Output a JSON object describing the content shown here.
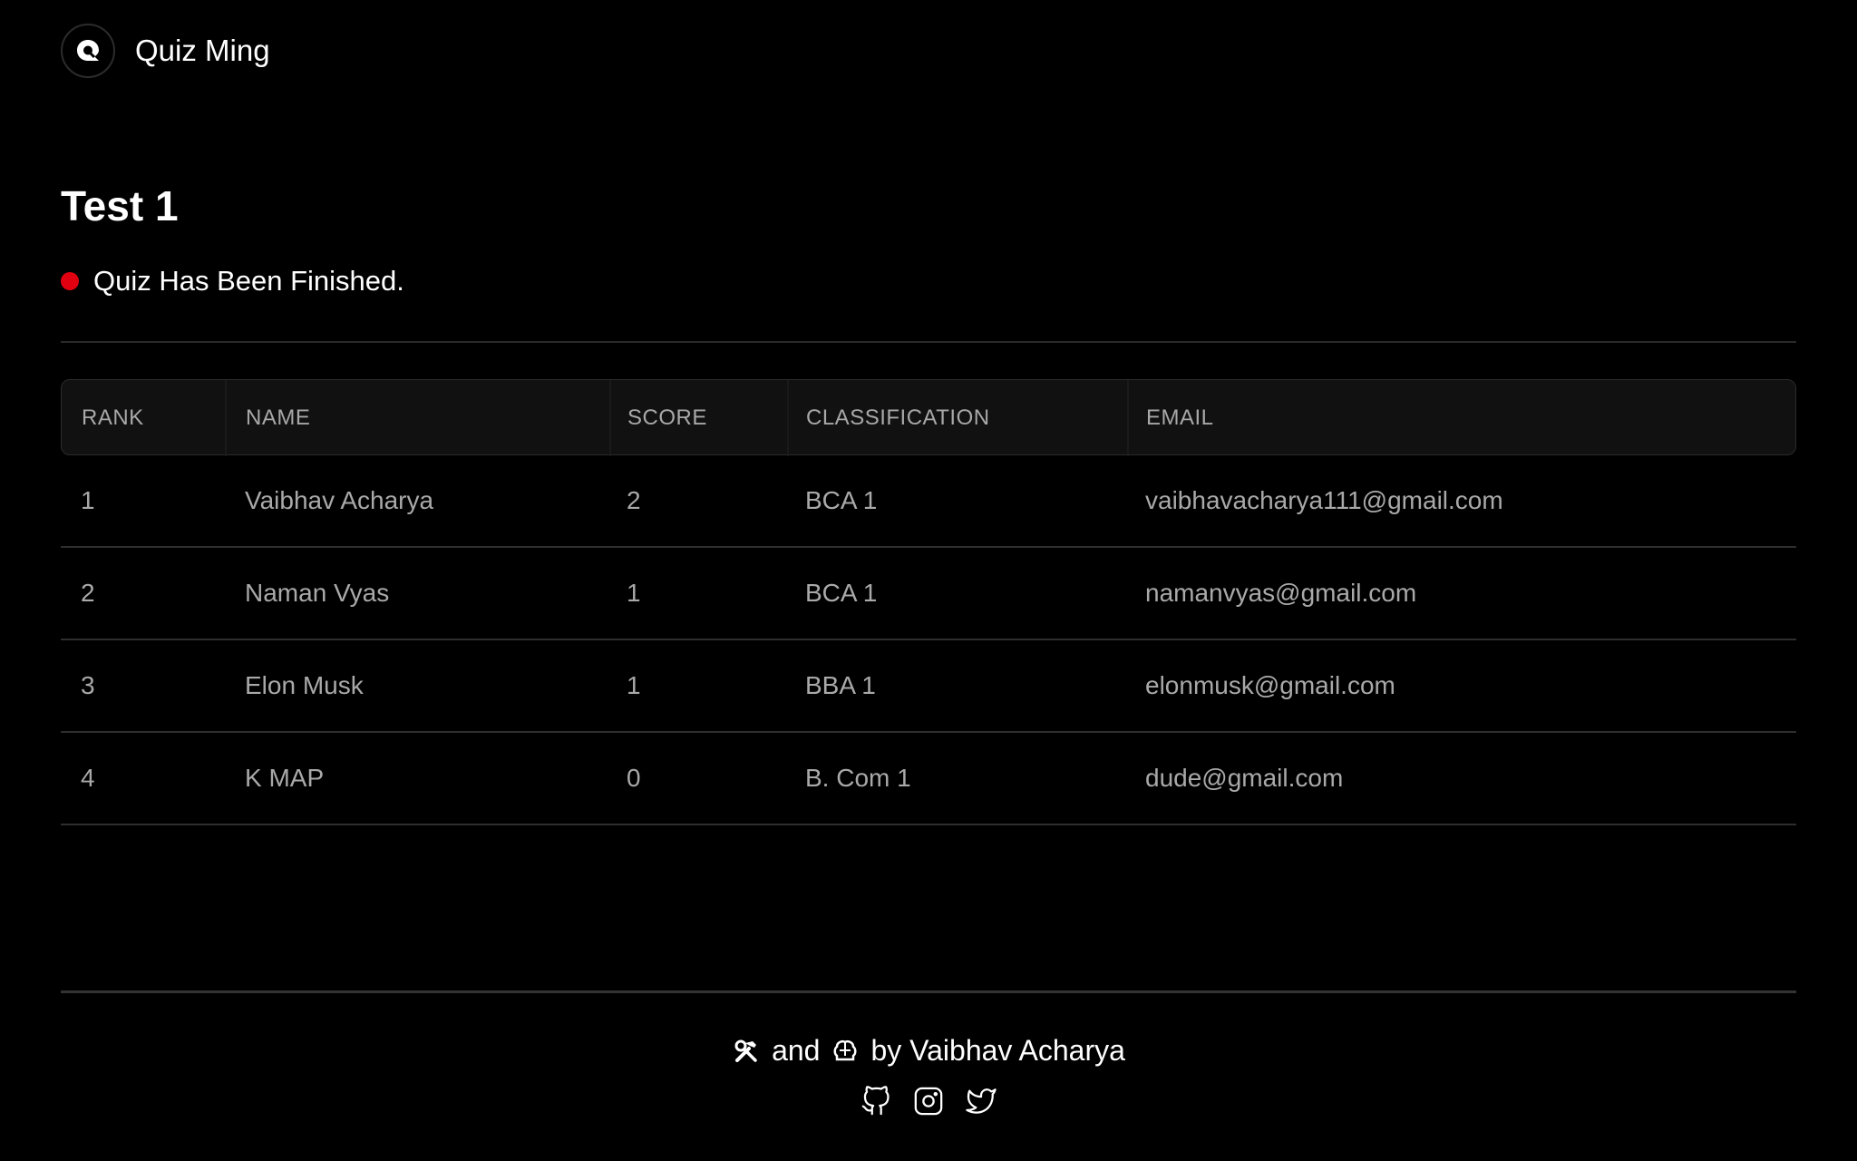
{
  "header": {
    "brand_name": "Quiz Ming",
    "logo_icon": "quiz-logo-icon"
  },
  "quiz": {
    "title": "Test 1",
    "status_text": "Quiz Has Been Finished.",
    "status_color": "#e00010"
  },
  "table": {
    "columns": [
      "RANK",
      "NAME",
      "SCORE",
      "CLASSIFICATION",
      "EMAIL"
    ],
    "rows": [
      {
        "rank": "1",
        "name": "Vaibhav Acharya",
        "score": "2",
        "classification": "BCA 1",
        "email": "vaibhavacharya111@gmail.com"
      },
      {
        "rank": "2",
        "name": "Naman Vyas",
        "score": "1",
        "classification": "BCA 1",
        "email": "namanvyas@gmail.com"
      },
      {
        "rank": "3",
        "name": "Elon Musk",
        "score": "1",
        "classification": "BBA 1",
        "email": "elonmusk@gmail.com"
      },
      {
        "rank": "4",
        "name": "K MAP",
        "score": "0",
        "classification": "B. Com 1",
        "email": "dude@gmail.com"
      }
    ]
  },
  "footer": {
    "and_text": "and",
    "by_text": "by Vaibhav Acharya",
    "tools_icon": "hammer-wrench-icon",
    "brain_icon": "brain-icon",
    "social_icons": [
      "github-icon",
      "instagram-icon",
      "twitter-icon"
    ]
  }
}
